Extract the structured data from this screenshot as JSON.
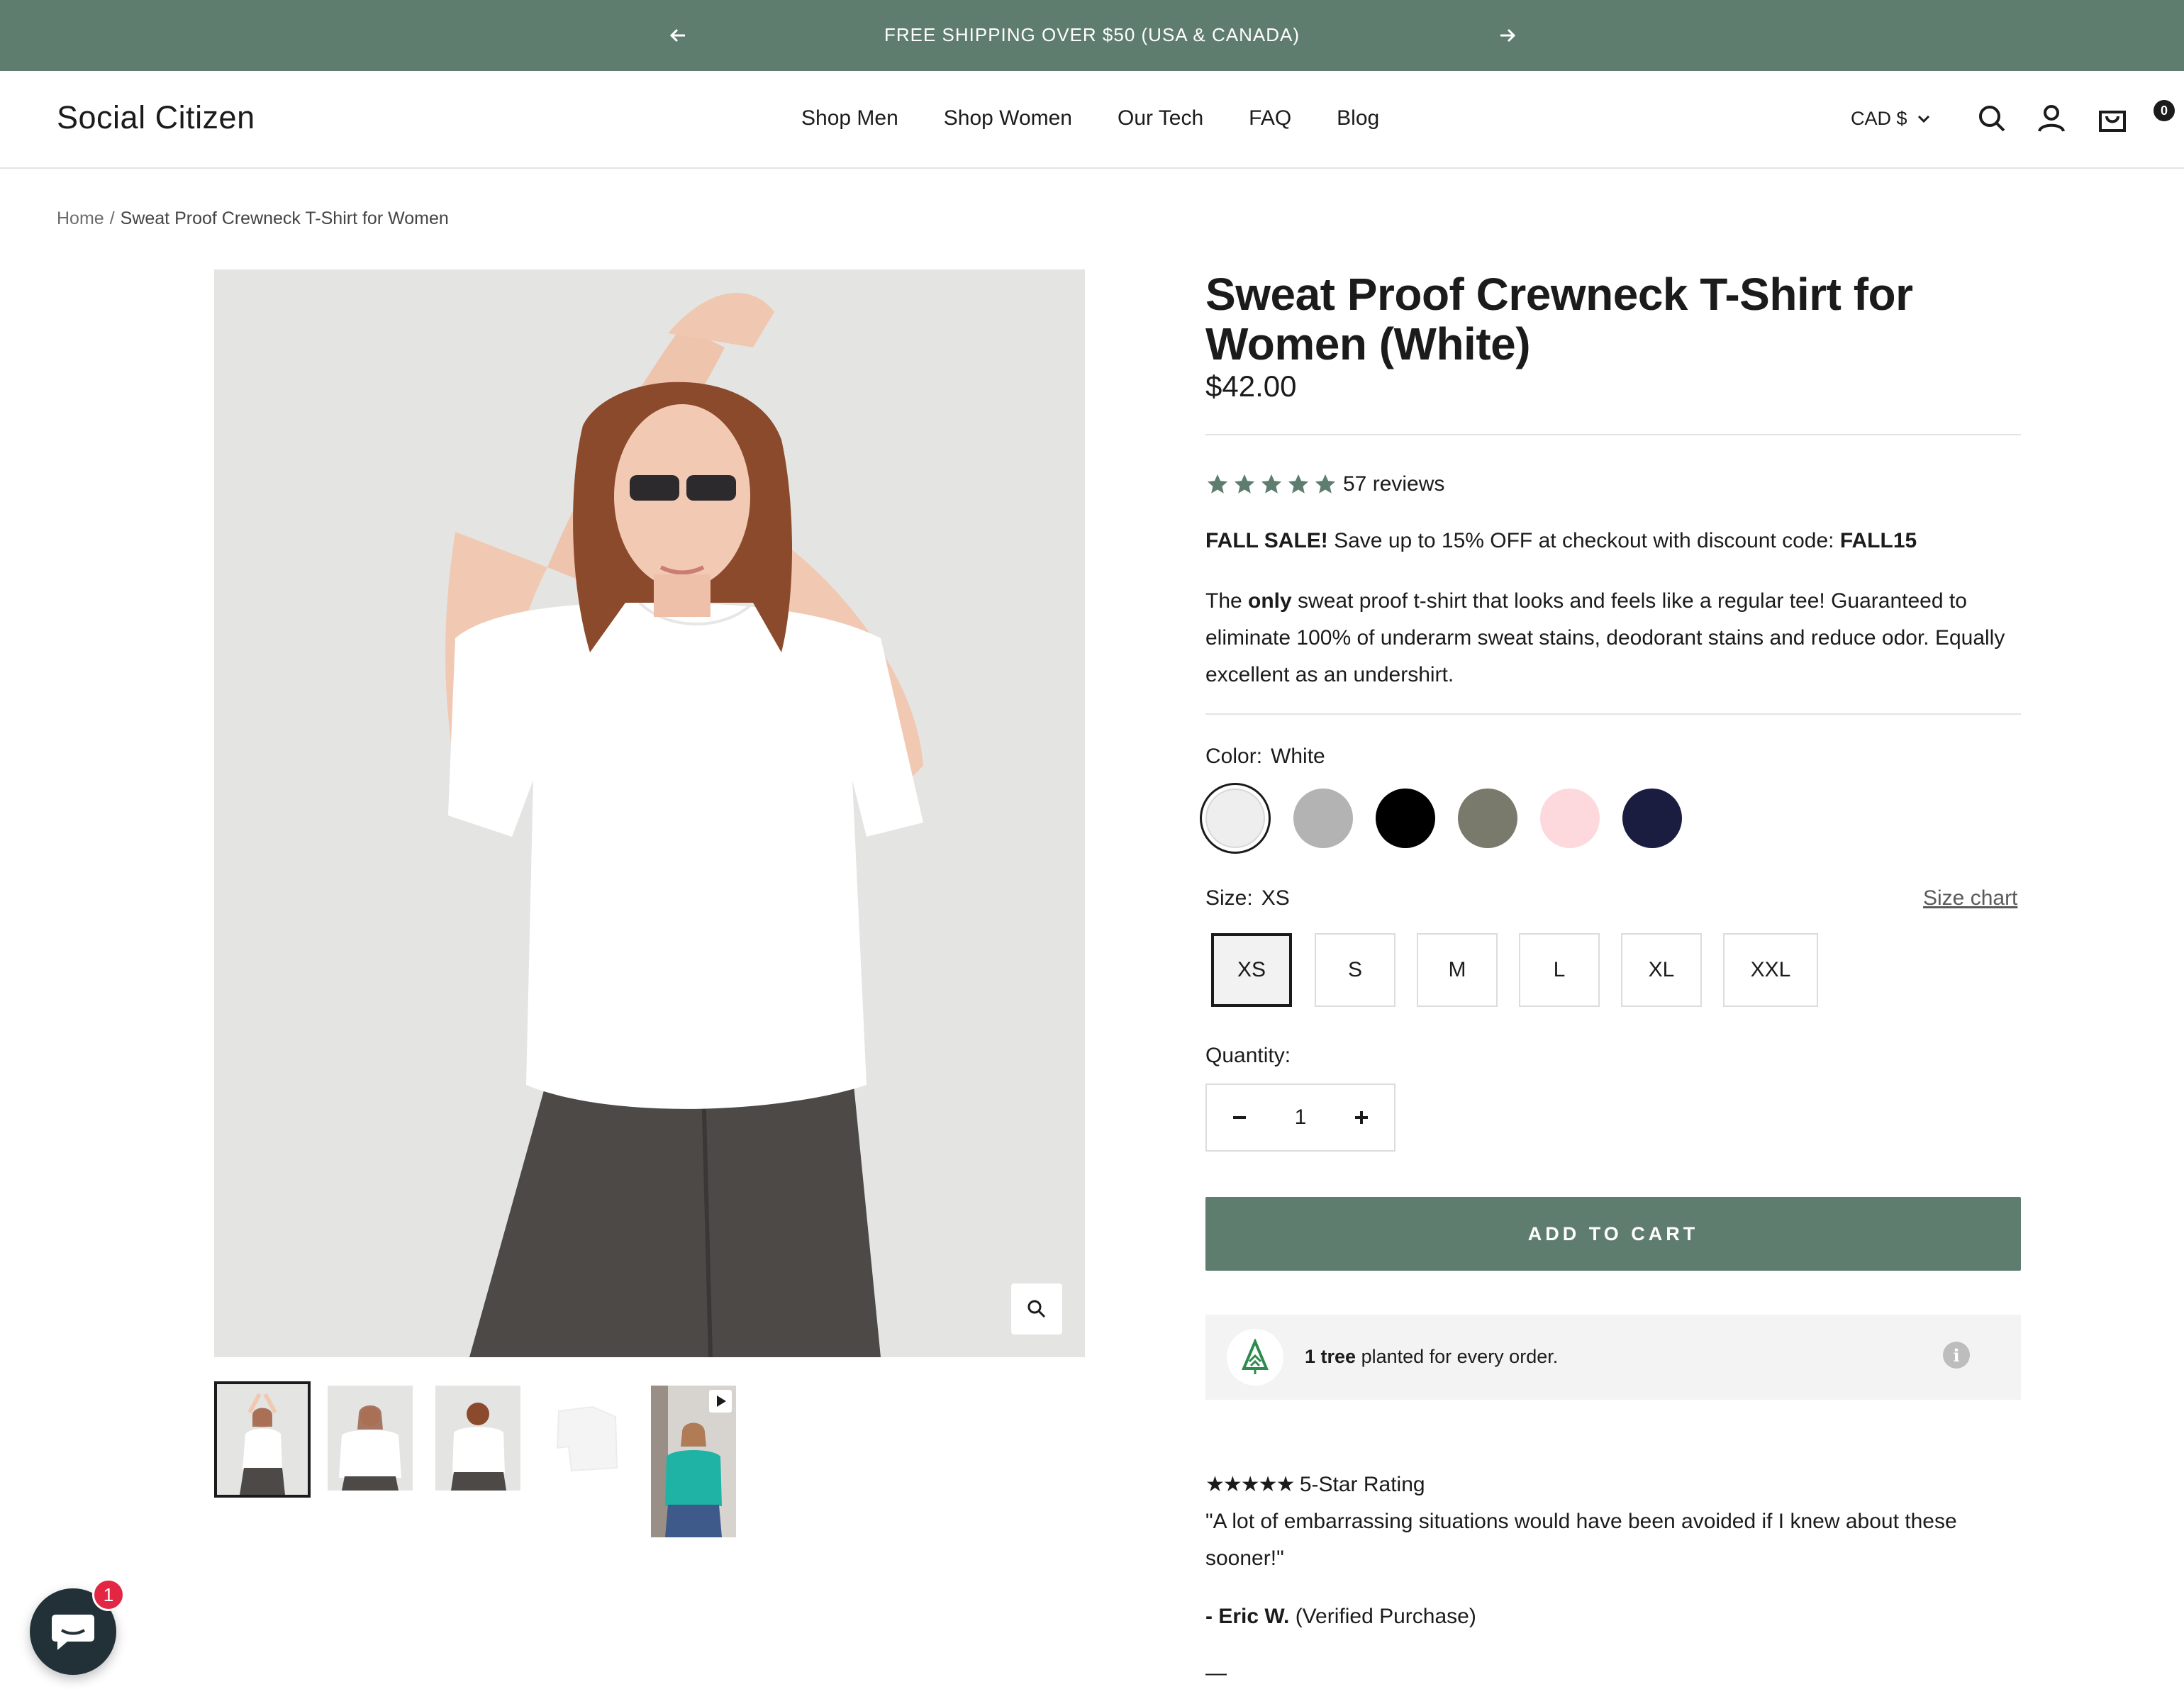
{
  "announcement": {
    "text": "FREE SHIPPING OVER $50 (USA & CANADA)"
  },
  "header": {
    "logo": "Social Citizen",
    "nav": [
      "Shop Men",
      "Shop Women",
      "Our Tech",
      "FAQ",
      "Blog"
    ],
    "currency": "CAD $",
    "cart_count": "0"
  },
  "breadcrumb": {
    "home": "Home",
    "separator": "/",
    "current": "Sweat Proof Crewneck T-Shirt for Women"
  },
  "product": {
    "title": "Sweat Proof Crewneck T-Shirt for Women (White)",
    "price": "$42.00",
    "rating_stars": 5,
    "reviews": "57 reviews",
    "sale_bold": "FALL SALE!",
    "sale_text": " Save up to 15% OFF at checkout with discount code: ",
    "sale_code": "FALL15",
    "desc_1": "The ",
    "desc_bold": "only",
    "desc_2": " sweat proof t-shirt that looks and feels like a regular tee! Guaranteed to eliminate 100% of underarm sweat stains, deodorant stains and reduce odor. Equally excellent as an undershirt.",
    "color_label": "Color:",
    "color_value": "White",
    "colors": [
      "#eeeeee",
      "#b3b3b3",
      "#000000",
      "#7a7a6c",
      "#fdd9de",
      "#1b1d40"
    ],
    "size_label": "Size:",
    "size_value": "XS",
    "size_chart": "Size chart",
    "sizes": [
      "XS",
      "S",
      "M",
      "L",
      "XL",
      "XXL"
    ],
    "quantity_label": "Quantity:",
    "quantity": "1",
    "add_to_cart": "ADD TO CART",
    "tree_bold": "1 tree",
    "tree_text": " planted for every order.",
    "tree_info": "i"
  },
  "review": {
    "stars": "★★★★★",
    "rating_text": " 5-Star Rating",
    "quote": "\"A lot of embarrassing situations would have been avoided if I knew about these sooner!\"",
    "author_bold": "- Eric W.",
    "author_rest": " (Verified Purchase)",
    "dash": "—"
  },
  "chat": {
    "badge": "1"
  },
  "colors": {
    "brand_green": "#5f7d6f",
    "text": "#1c1b1b",
    "star": "#5f7d6f",
    "badge_red": "#e22644"
  }
}
